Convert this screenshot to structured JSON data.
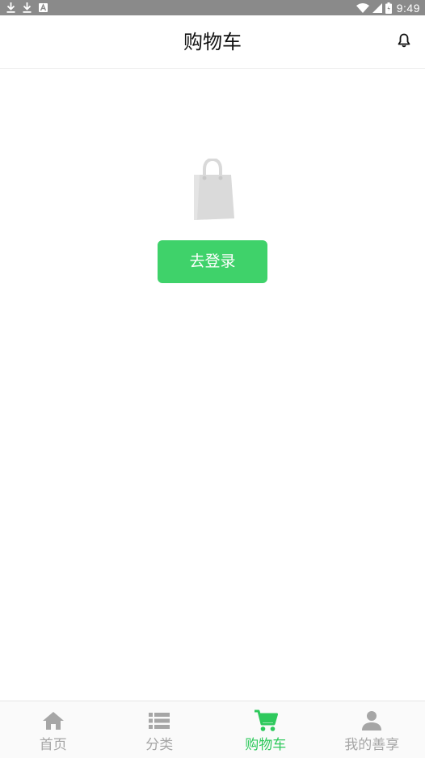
{
  "status_bar": {
    "time": "9:49",
    "background": "#8a8a8a"
  },
  "header": {
    "title": "购物车",
    "notification_icon": "bell-icon"
  },
  "empty_state": {
    "icon": "shopping-bag-icon",
    "login_button_label": "去登录",
    "button_color": "#3fd26a"
  },
  "tab_bar": {
    "active_color": "#2ec95c",
    "inactive_color": "#a6a6a6",
    "tabs": [
      {
        "label": "首页",
        "icon": "home-icon",
        "active": false
      },
      {
        "label": "分类",
        "icon": "list-icon",
        "active": false
      },
      {
        "label": "购物车",
        "icon": "cart-icon",
        "active": true
      },
      {
        "label": "我的善享",
        "icon": "person-icon",
        "active": false
      }
    ]
  }
}
